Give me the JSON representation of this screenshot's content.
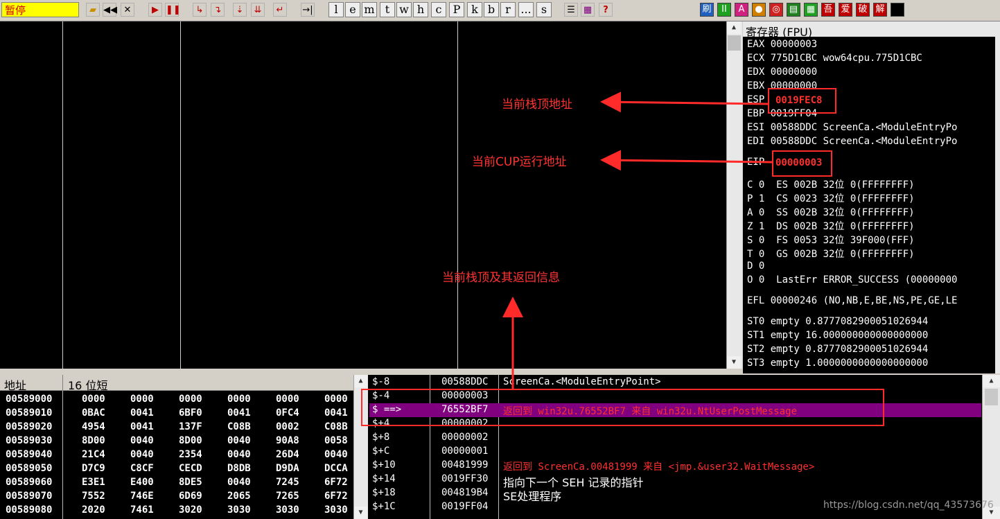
{
  "toolbar": {
    "status": "暂停",
    "letters": [
      "l",
      "e",
      "m",
      "t",
      "w",
      "h",
      "c",
      "P",
      "k",
      "b",
      "r",
      "...",
      "s"
    ],
    "right_icons": [
      "刷",
      "II",
      "A",
      "●",
      "◎",
      "▤",
      "▦",
      "吾",
      "爱",
      "破",
      "解"
    ]
  },
  "registers": {
    "title": "寄存器 (FPU)",
    "lines": [
      "EAX 00000003",
      "ECX 775D1CBC wow64cpu.775D1CBC",
      "EDX 00000000",
      "EBX 00000000",
      "ESP ",
      "EBP 0019FF04",
      "ESI 00588DDC ScreenCa.<ModuleEntryPo",
      "EDI 00588DDC ScreenCa.<ModuleEntryPo",
      "EIP ",
      "C 0  ES 002B 32位 0(FFFFFFFF)",
      "P 1  CS 0023 32位 0(FFFFFFFF)",
      "A 0  SS 002B 32位 0(FFFFFFFF)",
      "Z 1  DS 002B 32位 0(FFFFFFFF)",
      "S 0  FS 0053 32位 39F000(FFF)",
      "T 0  GS 002B 32位 0(FFFFFFFF)",
      "D 0",
      "O 0  LastErr ERROR_SUCCESS (00000000",
      "EFL 00000246 (NO,NB,E,BE,NS,PE,GE,LE",
      "ST0 empty 0.8777082900051026944",
      "ST1 empty 16.000000000000000000",
      "ST2 empty 0.8777082900051026944",
      "ST3 empty 1.0000000000000000000"
    ],
    "esp_value": "0019FEC8",
    "eip_value": "00000003"
  },
  "dump": {
    "col_address": "地址",
    "col_hex": "16 位短",
    "rows": [
      {
        "addr": "00589000",
        "vals": [
          "0000",
          "0000",
          "0000",
          "0000",
          "0000",
          "0000"
        ]
      },
      {
        "addr": "00589010",
        "vals": [
          "0BAC",
          "0041",
          "6BF0",
          "0041",
          "0FC4",
          "0041"
        ]
      },
      {
        "addr": "00589020",
        "vals": [
          "4954",
          "0041",
          "137F",
          "C08B",
          "0002",
          "C08B"
        ]
      },
      {
        "addr": "00589030",
        "vals": [
          "8D00",
          "0040",
          "8D00",
          "0040",
          "90A8",
          "0058"
        ]
      },
      {
        "addr": "00589040",
        "vals": [
          "21C4",
          "0040",
          "2354",
          "0040",
          "26D4",
          "0040"
        ]
      },
      {
        "addr": "00589050",
        "vals": [
          "D7C9",
          "C8CF",
          "CECD",
          "D8DB",
          "D9DA",
          "DCCA"
        ]
      },
      {
        "addr": "00589060",
        "vals": [
          "E3E1",
          "E400",
          "8DE5",
          "0040",
          "7245",
          "6F72"
        ]
      },
      {
        "addr": "00589070",
        "vals": [
          "7552",
          "746E",
          "6D69",
          "2065",
          "7265",
          "6F72"
        ]
      },
      {
        "addr": "00589080",
        "vals": [
          "2020",
          "7461",
          "3020",
          "3030",
          "3030",
          "3030"
        ]
      }
    ]
  },
  "stack": {
    "rows": [
      {
        "off": "$-8",
        "val": "00588DDC",
        "cmt": "ScreenCa.<ModuleEntryPoint>"
      },
      {
        "off": "$-4",
        "val": "00000003",
        "cmt": ""
      },
      {
        "off": "$ ==>",
        "val": "76552BF7",
        "cmt": "返回到 win32u.76552BF7 来自 win32u.NtUserPostMessage"
      },
      {
        "off": "$+4",
        "val": "00000002",
        "cmt": ""
      },
      {
        "off": "$+8",
        "val": "00000002",
        "cmt": ""
      },
      {
        "off": "$+C",
        "val": "00000001",
        "cmt": ""
      },
      {
        "off": "$+10",
        "val": "00481999",
        "cmt": "返回到 ScreenCa.00481999 来自 <jmp.&user32.WaitMessage>"
      },
      {
        "off": "$+14",
        "val": "0019FF30",
        "cmt": "指向下一个 SEH 记录的指针"
      },
      {
        "off": "$+18",
        "val": "004819B4",
        "cmt": "SE处理程序"
      },
      {
        "off": "$+1C",
        "val": "0019FF04",
        "cmt": ""
      }
    ]
  },
  "annotations": {
    "esp_note": "当前栈顶地址",
    "eip_note": "当前CUP运行地址",
    "stack_note": "当前栈顶及其返回信息"
  },
  "watermark": "https://blog.csdn.net/qq_43573676"
}
